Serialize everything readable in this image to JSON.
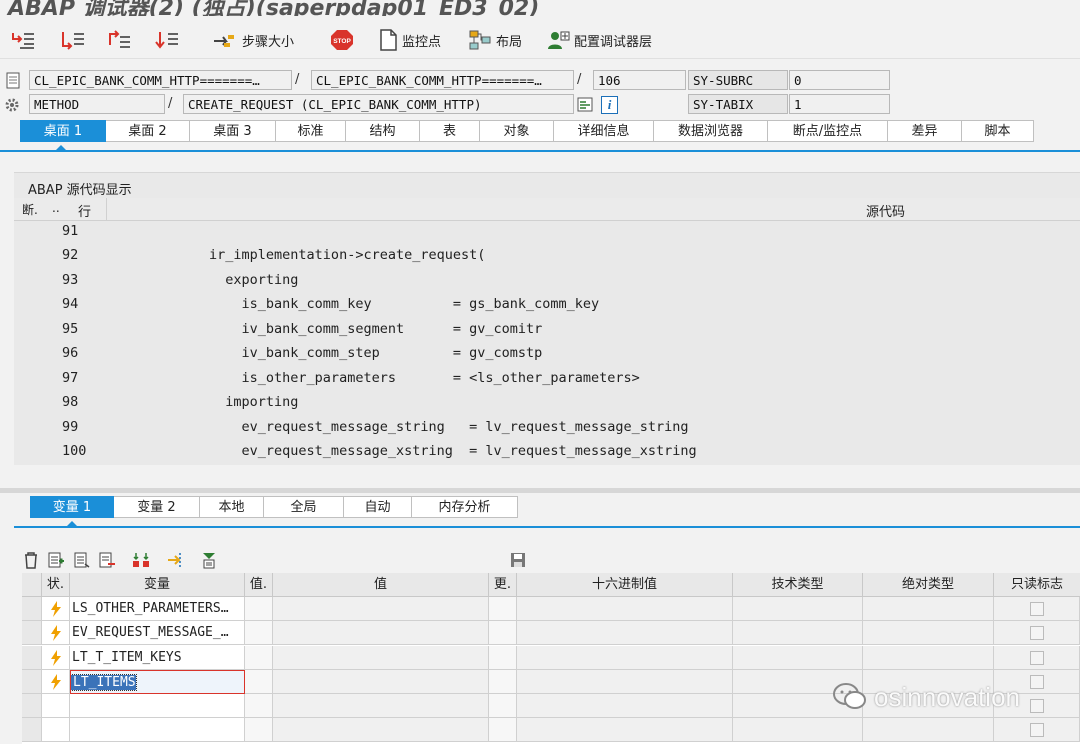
{
  "window_title": "ABAP 调试器(2) (独占)(saperpdap01_ED3_02)",
  "toolbar": {
    "step_size": "步骤大小",
    "watchpoint": "监控点",
    "layout": "布局",
    "configure_debugger_layer": "配置调试器层",
    "stop_icon_text": "STOP"
  },
  "info": {
    "program1": "CL_EPIC_BANK_COMM_HTTP=======…",
    "program2": "CL_EPIC_BANK_COMM_HTTP=======…",
    "line": "106",
    "type": "METHOD",
    "method": "CREATE_REQUEST (CL_EPIC_BANK_COMM_HTTP)",
    "sy_subrc_label": "SY-SUBRC",
    "sy_subrc_value": "0",
    "sy_tabix_label": "SY-TABIX",
    "sy_tabix_value": "1",
    "info_icon": "i",
    "sep": "/"
  },
  "main_tabs": [
    "桌面 1",
    "桌面 2",
    "桌面 3",
    "标准",
    "结构",
    "表",
    "对象",
    "详细信息",
    "数据浏览器",
    "断点/监控点",
    "差异",
    "脚本"
  ],
  "source": {
    "panel_title": "ABAP 源代码显示",
    "col_breakpoint": "断.",
    "col_dots": "..",
    "col_line": "行",
    "col_source": "源代码",
    "lines": [
      {
        "no": "91",
        "code": ""
      },
      {
        "no": "92",
        "code": "        ir_implementation->create_request("
      },
      {
        "no": "93",
        "code": "          exporting"
      },
      {
        "no": "94",
        "code": "            is_bank_comm_key          = gs_bank_comm_key"
      },
      {
        "no": "95",
        "code": "            iv_bank_comm_segment      = gv_comitr"
      },
      {
        "no": "96",
        "code": "            iv_bank_comm_step         = gv_comstp"
      },
      {
        "no": "97",
        "code": "            is_other_parameters       = <ls_other_parameters>"
      },
      {
        "no": "98",
        "code": "          importing"
      },
      {
        "no": "99",
        "code": "            ev_request_message_string   = lv_request_message_string"
      },
      {
        "no": "100",
        "code": "            ev_request_message_xstring  = lv_request_message_xstring"
      }
    ]
  },
  "var_tabs": [
    "变量 1",
    "变量 2",
    "本地",
    "全局",
    "自动",
    "内存分析"
  ],
  "var_table": {
    "headers": [
      "状.",
      "变量",
      "值.",
      "值",
      "更.",
      "十六进制值",
      "技术类型",
      "绝对类型",
      "只读标志"
    ],
    "rows": [
      {
        "name": "LS_OTHER_PARAMETERS…"
      },
      {
        "name": "EV_REQUEST_MESSAGE_…"
      },
      {
        "name": "LT_T_ITEM_KEYS"
      },
      {
        "name": "LT_ITEMS"
      }
    ]
  },
  "watermark": "osinnovation",
  "colors": {
    "accent": "#1b8fd8",
    "status_icon": "#f0a000"
  }
}
